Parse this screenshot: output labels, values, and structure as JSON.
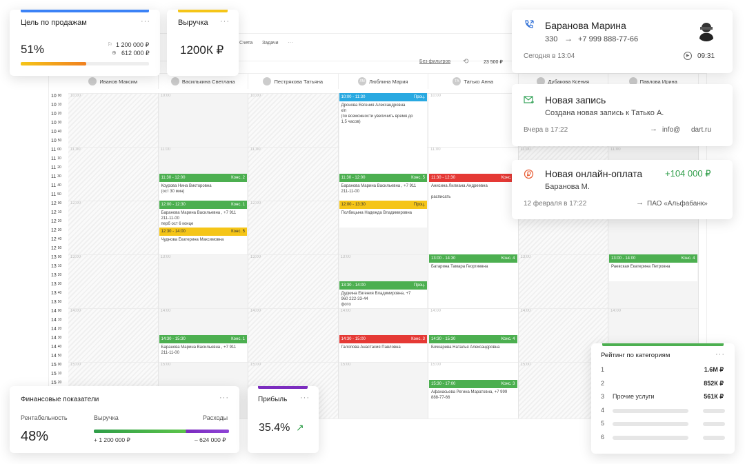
{
  "calendar": {
    "tabs": [
      "Счета",
      "Задачи"
    ],
    "filter_label": "Без фильтров",
    "amount": "23 500 ₽",
    "columns": [
      {
        "name": "Иванов Максим",
        "initials": ""
      },
      {
        "name": "Василькина Светлана",
        "initials": ""
      },
      {
        "name": "Пестрякова Татьяна",
        "initials": ""
      },
      {
        "name": "Люблина Мария",
        "initials": "ЛМ"
      },
      {
        "name": "Татько Анна",
        "initials": "ТА"
      },
      {
        "name": "Дубакова Ксения",
        "initials": ""
      },
      {
        "name": "Павлова Ирина",
        "initials": ""
      }
    ],
    "times": [
      {
        "h": "10",
        "m": "00"
      },
      {
        "h": "10",
        "m": "10"
      },
      {
        "h": "10",
        "m": "20"
      },
      {
        "h": "10",
        "m": "30"
      },
      {
        "h": "10",
        "m": "40"
      },
      {
        "h": "10",
        "m": "50"
      },
      {
        "h": "11",
        "m": "00"
      },
      {
        "h": "11",
        "m": "10"
      },
      {
        "h": "11",
        "m": "20"
      },
      {
        "h": "11",
        "m": "30"
      },
      {
        "h": "11",
        "m": "40"
      },
      {
        "h": "11",
        "m": "50"
      },
      {
        "h": "12",
        "m": "00"
      },
      {
        "h": "12",
        "m": "10"
      },
      {
        "h": "12",
        "m": "20"
      },
      {
        "h": "12",
        "m": "30"
      },
      {
        "h": "12",
        "m": "40"
      },
      {
        "h": "12",
        "m": "50"
      },
      {
        "h": "13",
        "m": "00"
      },
      {
        "h": "13",
        "m": "10"
      },
      {
        "h": "13",
        "m": "20"
      },
      {
        "h": "13",
        "m": "30"
      },
      {
        "h": "13",
        "m": "40"
      },
      {
        "h": "13",
        "m": "50"
      },
      {
        "h": "14",
        "m": "00"
      },
      {
        "h": "14",
        "m": "10"
      },
      {
        "h": "14",
        "m": "20"
      },
      {
        "h": "14",
        "m": "30"
      },
      {
        "h": "14",
        "m": "40"
      },
      {
        "h": "14",
        "m": "50"
      },
      {
        "h": "15",
        "m": "00"
      },
      {
        "h": "15",
        "m": "10"
      },
      {
        "h": "15",
        "m": "20"
      }
    ],
    "slot_marks": [
      "10:00",
      "11:00",
      "12:00",
      "13:00",
      "14:00",
      "15:00"
    ],
    "events": [
      {
        "col": 3,
        "start": "10:00",
        "end": "11:30",
        "color": "#29a9e1",
        "time": "10:00 - 11:30",
        "tag": "Проц.",
        "lines": [
          "Дронова Евгения Александровна",
          "к/п",
          "(по возможности увеличить время до",
          "1,5 часов)"
        ]
      },
      {
        "col": 1,
        "start": "11:30",
        "end": "12:00",
        "color": "#4caf50",
        "time": "11:30 - 12:00",
        "tag": "Конс. 2",
        "lines": [
          "Коурова Нина Викторовна",
          "(ост 30 мин)"
        ]
      },
      {
        "col": 3,
        "start": "11:30",
        "end": "12:00",
        "color": "#4caf50",
        "time": "11:30 - 12:00",
        "tag": "Конс. 5",
        "lines": [
          "Баранова Марина Васильевна , +7 911",
          "211-11-00"
        ]
      },
      {
        "col": 4,
        "start": "11:30",
        "end": "12:30",
        "color": "#e53935",
        "time": "11:30 - 12:30",
        "tag": "Конс. 3",
        "lines": [
          "Анисина Лилиана Андреевна",
          "",
          "расписать"
        ]
      },
      {
        "col": 1,
        "start": "12:00",
        "end": "12:30",
        "color": "#4caf50",
        "time": "12:00 - 12:30",
        "tag": "Конс. 1",
        "lines": [
          "Баранова Марина Васильевна , +7 911",
          "211-11-00",
          "перб ост 6 конце"
        ]
      },
      {
        "col": 3,
        "start": "12:00",
        "end": "12:30",
        "color": "#f5c518",
        "time": "12:00 - 13:30",
        "tag": "Проц.",
        "lines": [
          "Полбицына Надежда Владимировна"
        ]
      },
      {
        "col": 1,
        "start": "12:30",
        "end": "13:00",
        "color": "#f5c518",
        "time": "12:30 - 14:00",
        "tag": "Конс. 5",
        "lines": [
          "Чуднова Екатерина Максимовна"
        ]
      },
      {
        "col": 4,
        "start": "13:00",
        "end": "13:30",
        "color": "#4caf50",
        "time": "13:00 - 14:30",
        "tag": "Конс. 4",
        "lines": [
          "Батарина Тамара Георгиевна"
        ]
      },
      {
        "col": 6,
        "start": "13:00",
        "end": "13:30",
        "color": "#4caf50",
        "time": "13:00 - 14:00",
        "tag": "Конс. 4",
        "lines": [
          "Раевская Екатерина Петровна"
        ]
      },
      {
        "col": 3,
        "start": "13:30",
        "end": "14:00",
        "color": "#4caf50",
        "time": "13:30 - 14:00",
        "tag": "Проц.",
        "lines": [
          "Дудкина Евгения Владимировна, +7",
          "960 222-33-44",
          "фото"
        ]
      },
      {
        "col": 1,
        "start": "14:30",
        "end": "15:00",
        "color": "#4caf50",
        "time": "14:30 - 15:30",
        "tag": "Конс. 1",
        "lines": [
          "Баранова Марина Васильевна , +7 911",
          "211-11-00"
        ]
      },
      {
        "col": 3,
        "start": "14:30",
        "end": "15:00",
        "color": "#e53935",
        "time": "14:30 - 15:00",
        "tag": "Конс. 3",
        "lines": [
          "Галопова Анастасия Павловна"
        ]
      },
      {
        "col": 4,
        "start": "14:30",
        "end": "15:00",
        "color": "#4caf50",
        "time": "14:30 - 15:30",
        "tag": "Конс. 4",
        "lines": [
          "Бочкарева Наталья Александровна"
        ]
      },
      {
        "col": 4,
        "start": "15:20",
        "end": "15:50",
        "color": "#4caf50",
        "time": "15:30 - 17:00",
        "tag": "Конс. 3",
        "lines": [
          "Афанасьева Регина Маратовна, +7 999",
          "888-77-66"
        ]
      }
    ]
  },
  "sales_goal": {
    "title": "Цель по продажам",
    "percent": "51%",
    "target": "1 200 000 ₽",
    "current": "612 000 ₽",
    "progress": 0.51,
    "more": "···"
  },
  "revenue": {
    "title": "Выручка",
    "value": "1200К ₽",
    "more": "···"
  },
  "call": {
    "name": "Баранова Марина",
    "ext": "330",
    "phone": "+7 999 888-77-66",
    "when": "Сегодня в 13:04",
    "duration": "09:31"
  },
  "new_record": {
    "title": "Новая запись",
    "text": "Создана новая запись к Татько А.",
    "when": "Вчера в 17:22",
    "email_user": "info@",
    "email_domain": "dart.ru"
  },
  "payment": {
    "title": "Новая онлайн-оплата",
    "amount": "+104 000 ₽",
    "payer": "Баранова М.",
    "when": "12 февраля в 17:22",
    "bank": "ПАО «Альфабанк»"
  },
  "finance": {
    "title": "Финансовые показатели",
    "profitability_label": "Рентабельность",
    "profitability": "48%",
    "revenue_label": "Выручка",
    "expenses_label": "Расходы",
    "revenue": "+ 1 200 000 ₽",
    "expenses": "– 624 000 ₽",
    "more": "···"
  },
  "profit": {
    "title": "Прибыль",
    "value": "35.4%",
    "more": "···"
  },
  "rating": {
    "title": "Рейтинг по категориям",
    "more": "···",
    "rows": [
      {
        "n": "1",
        "name": "",
        "value": "1.6М ₽"
      },
      {
        "n": "2",
        "name": "",
        "value": "852К ₽"
      },
      {
        "n": "3",
        "name": "Прочие услуги",
        "value": "561К ₽"
      },
      {
        "n": "4",
        "name": "",
        "value": ""
      },
      {
        "n": "5",
        "name": "",
        "value": ""
      },
      {
        "n": "6",
        "name": "",
        "value": ""
      }
    ]
  },
  "colors": {
    "green": "#4caf50",
    "red": "#e53935",
    "yellow": "#f5c518",
    "blue": "#29a9e1",
    "purple": "#7b2cbf",
    "accent_blue": "#3b82f6"
  }
}
